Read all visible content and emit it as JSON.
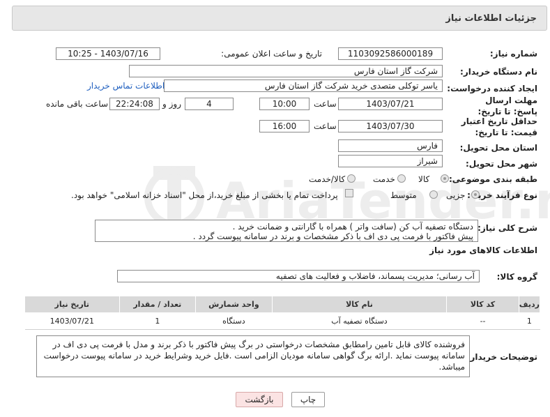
{
  "header": {
    "title": "جزئیات اطلاعات نیاز"
  },
  "fields": {
    "need_number_label": "شماره نیاز:",
    "need_number": "1103092586000189",
    "announce_label": "تاریخ و ساعت اعلان عمومی:",
    "announce_value": "1403/07/16 - 10:25",
    "buyer_org_label": "نام دستگاه خریدار:",
    "buyer_org": "شرکت گاز استان فارس",
    "requester_label": "ایجاد کننده درخواست:",
    "requester": "یاسر توکلی متصدی خرید شرکت گاز استان فارس",
    "contact_link": "اطلاعات تماس خریدار",
    "deadline_label": "مهلت ارسال پاسخ: تا تاریخ:",
    "deadline_date": "1403/07/21",
    "time_label": "ساعت",
    "deadline_time": "10:00",
    "days_value": "4",
    "days_label": "روز و",
    "remaining_time": "22:24:08",
    "remaining_label": "ساعت باقی مانده",
    "validity_label": "حداقل تاریخ اعتبار قیمت: تا تاریخ:",
    "validity_date": "1403/07/30",
    "validity_time": "16:00",
    "province_label": "استان محل تحویل:",
    "province": "فارس",
    "city_label": "شهر محل تحویل:",
    "city": "شیراز",
    "category_label": "طبقه بندی موضوعی:",
    "category_options": [
      "کالا",
      "خدمت",
      "کالا/خدمت"
    ],
    "category_selected": "کالا",
    "process_label": "نوع فرآیند خرید :",
    "process_options": [
      "جزیی",
      "متوسط"
    ],
    "process_selected": "جزیی",
    "payment_note": "پرداخت تمام یا بخشی از مبلغ خرید،از محل \"اسناد خزانه اسلامی\" خواهد بود."
  },
  "description": {
    "label": "شرح کلی نیاز:",
    "text": "دستگاه تصفیه آب کن (سافت واتر ) همراه با گارانتی و ضمانت خرید .\nپیش فاکتور با فرمت پی دی اف با ذکر مشخصات و برند در سامانه پیوست گردد ."
  },
  "goods": {
    "section_title": "اطلاعات کالاهای مورد نیاز",
    "group_label": "گروه کالا:",
    "group_value": "آب رسانی؛ مدیریت پسماند، فاضلاب و فعالیت های تصفیه",
    "columns": [
      "ردیف",
      "کد کالا",
      "نام کالا",
      "واحد شمارش",
      "تعداد / مقدار",
      "تاریخ نیاز"
    ],
    "rows": [
      [
        "1",
        "--",
        "دستگاه تصفیه آب",
        "دستگاه",
        "1",
        "1403/07/21"
      ]
    ]
  },
  "buyer_notes": {
    "label": "توضیحات خریدار:",
    "text": "فروشنده کالای قابل تامین رامطابق مشخصات درخواستی در برگ پیش فاکتور با ذکر برند و مدل با فرمت پی دی اف در سامانه پیوست نماید .ارائه برگ گواهی سامانه مودیان الزامی است .فایل خرید وشرایط خرید در سامانه پیوست درخواست میباشد."
  },
  "buttons": {
    "print": "چاپ",
    "back": "بازگشت"
  },
  "watermark": "AriaTender.net",
  "colors": {
    "link": "#1f5fbf",
    "back_button_bg": "#fbe3e3",
    "header_bg": "#e7e7e7"
  }
}
